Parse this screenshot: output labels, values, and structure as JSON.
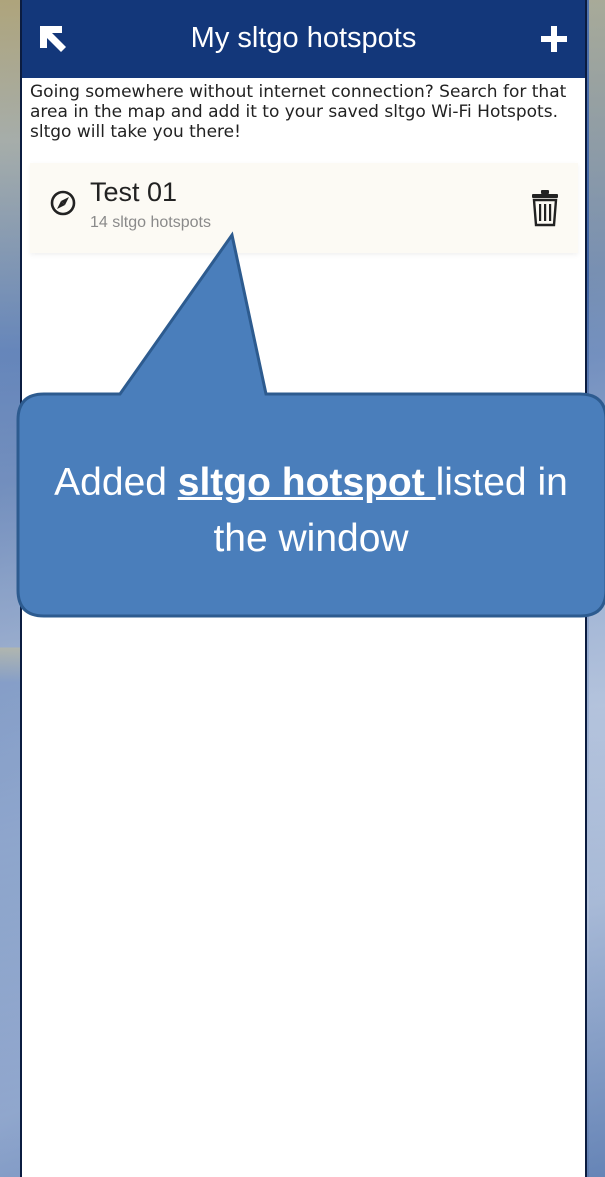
{
  "app_bar": {
    "title": "My sltgo hotspots",
    "back_icon": "arrow-up-left-icon",
    "add_icon": "plus-icon",
    "color": "#13377a"
  },
  "description": "Going somewhere without internet connection? Search for that area in the map and add it to your saved sltgo Wi-Fi Hotspots. sltgo will take you there!",
  "hotspots": [
    {
      "name": "Test 01",
      "count": "14 sltgo hotspots",
      "icon": "compass-icon",
      "action_icon": "trash-icon"
    }
  ],
  "callout": {
    "prefix": "Added ",
    "emphasis": "sltgo hotspot ",
    "suffix": " listed in the window",
    "color": "#4a7ebb"
  }
}
